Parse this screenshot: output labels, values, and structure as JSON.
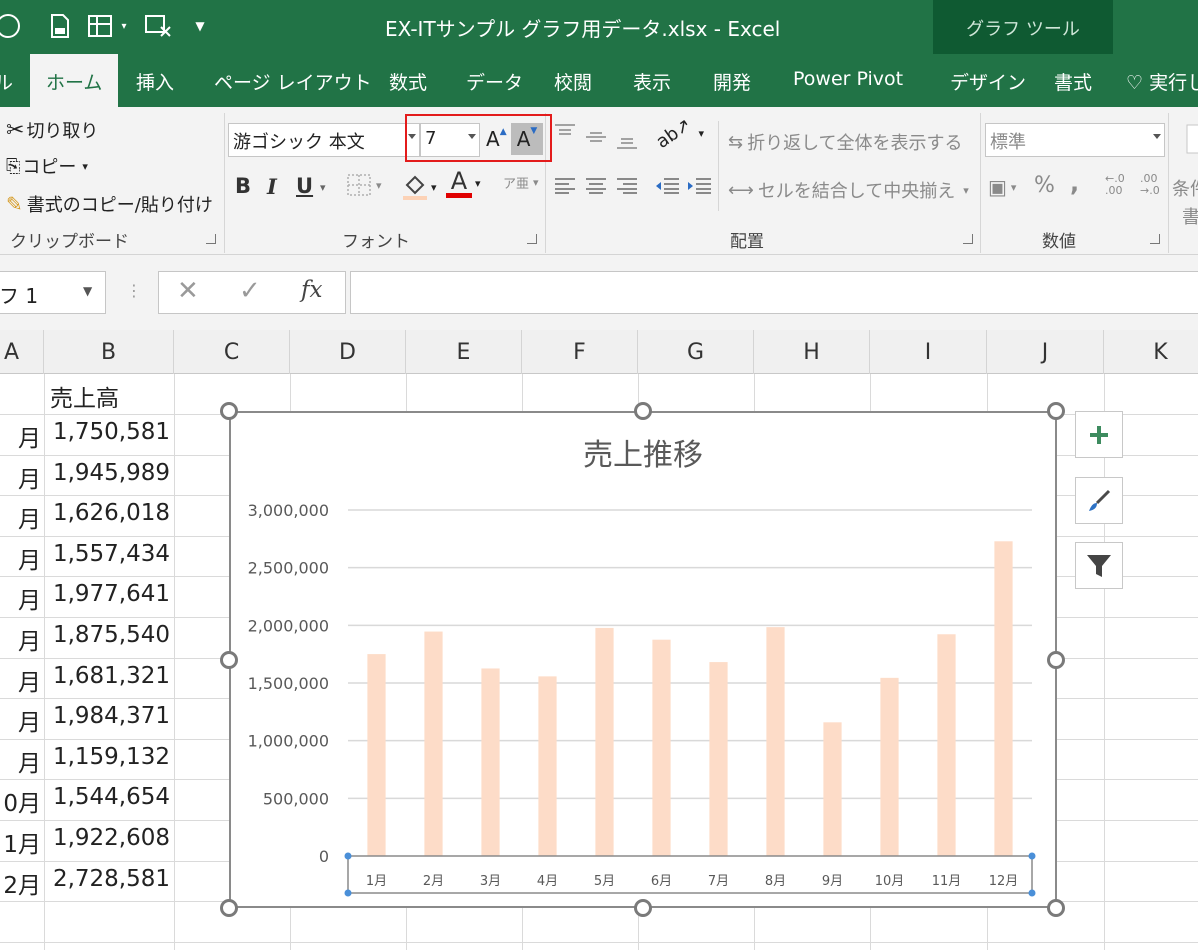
{
  "titlebar": {
    "doc_title": "EX-ITサンプル  グラフ用データ.xlsx  -  Excel",
    "context_title": "グラフ ツール"
  },
  "tabs": [
    {
      "label": "ホーム",
      "active": true
    },
    {
      "label": "挿入"
    },
    {
      "label": "ページ レイアウト"
    },
    {
      "label": "数式"
    },
    {
      "label": "データ"
    },
    {
      "label": "校閲"
    },
    {
      "label": "表示"
    },
    {
      "label": "開発"
    },
    {
      "label": "Power Pivot"
    },
    {
      "label": "デザイン"
    },
    {
      "label": "書式"
    },
    {
      "label": "実行し"
    }
  ],
  "ribbon": {
    "clipboard": {
      "cut": "切り取り",
      "copy": "コピー",
      "format_painter": "書式のコピー/貼り付け",
      "label": "クリップボード"
    },
    "font": {
      "font_name": "游ゴシック 本文",
      "font_size": "7",
      "bold": "B",
      "italic": "I",
      "underline": "U",
      "grow": "A",
      "shrink": "A",
      "font_color_letter": "A",
      "label": "フォント"
    },
    "alignment": {
      "wrap_text": "折り返して全体を表示する",
      "merge_center": "セルを結合して中央揃え",
      "label": "配置"
    },
    "number": {
      "format": "標準",
      "percent": "%",
      "comma": ",",
      "label": "数値"
    },
    "styles": {
      "cond1": "条件",
      "cond2": "書"
    }
  },
  "formula_bar": {
    "name_box": "フ 1",
    "fx": "fx",
    "formula": ""
  },
  "columns": [
    "A",
    "B",
    "C",
    "D",
    "E",
    "F",
    "G",
    "H",
    "I",
    "J",
    "K"
  ],
  "sheet": {
    "header_b": "売上高",
    "rows": [
      {
        "a": "月",
        "b": "1,750,581"
      },
      {
        "a": "月",
        "b": "1,945,989"
      },
      {
        "a": "月",
        "b": "1,626,018"
      },
      {
        "a": "月",
        "b": "1,557,434"
      },
      {
        "a": "月",
        "b": "1,977,641"
      },
      {
        "a": "月",
        "b": "1,875,540"
      },
      {
        "a": "月",
        "b": "1,681,321"
      },
      {
        "a": "月",
        "b": "1,984,371"
      },
      {
        "a": "月",
        "b": "1,159,132"
      },
      {
        "a": "0月",
        "b": "1,544,654"
      },
      {
        "a": "1月",
        "b": "1,922,608"
      },
      {
        "a": "2月",
        "b": "2,728,581"
      }
    ]
  },
  "chart_data": {
    "type": "bar",
    "title": "売上推移",
    "categories": [
      "1月",
      "2月",
      "3月",
      "4月",
      "5月",
      "6月",
      "7月",
      "8月",
      "9月",
      "10月",
      "11月",
      "12月"
    ],
    "values": [
      1750581,
      1945989,
      1626018,
      1557434,
      1977641,
      1875540,
      1681321,
      1984371,
      1159132,
      1544654,
      1922608,
      2728581
    ],
    "yticks": [
      "0",
      "500,000",
      "1,000,000",
      "1,500,000",
      "2,000,000",
      "2,500,000",
      "3,000,000"
    ],
    "ylim": [
      0,
      3000000
    ],
    "grid": true,
    "bar_color": "#fddcc8"
  },
  "colors": {
    "excel_green": "#217346",
    "context_green": "#0f5a32",
    "highlight_red": "#e31b1b"
  }
}
